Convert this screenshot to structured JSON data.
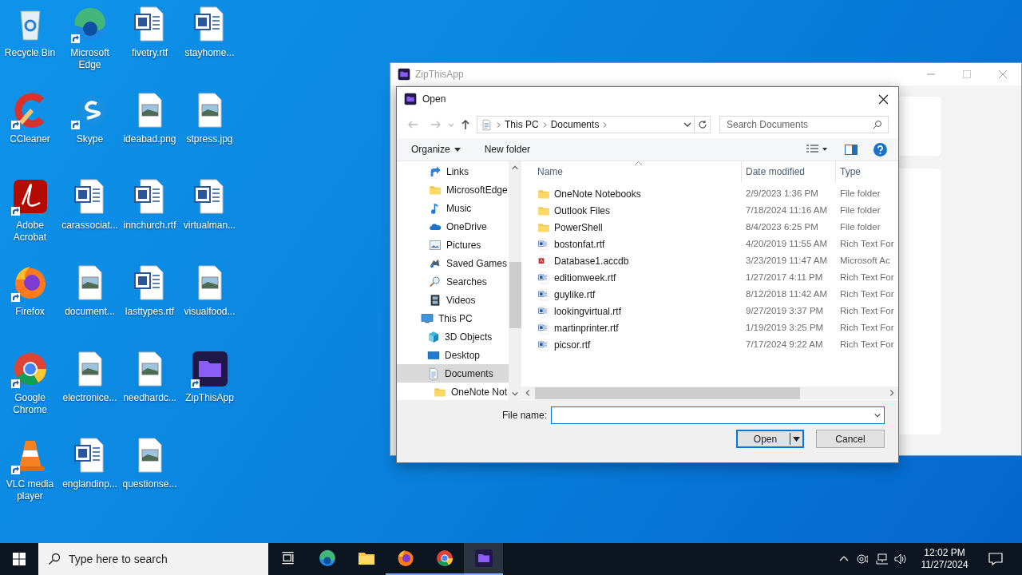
{
  "desktop": {
    "icons": [
      {
        "label": "Recycle Bin",
        "kind": "recycle",
        "shortcut": false
      },
      {
        "label": "CCleaner",
        "kind": "ccleaner",
        "shortcut": true
      },
      {
        "label": "Adobe Acrobat",
        "kind": "acrobat",
        "shortcut": true
      },
      {
        "label": "Firefox",
        "kind": "firefox",
        "shortcut": true
      },
      {
        "label": "Google Chrome",
        "kind": "chrome",
        "shortcut": true
      },
      {
        "label": "VLC media player",
        "kind": "vlc",
        "shortcut": true
      },
      {
        "label": "Microsoft Edge",
        "kind": "edge",
        "shortcut": true
      },
      {
        "label": "Skype",
        "kind": "skype",
        "shortcut": true
      },
      {
        "label": "carassociat...",
        "kind": "word",
        "shortcut": false
      },
      {
        "label": "document...",
        "kind": "image",
        "shortcut": false
      },
      {
        "label": "electronice...",
        "kind": "image",
        "shortcut": false
      },
      {
        "label": "englandinp...",
        "kind": "word",
        "shortcut": false
      },
      {
        "label": "fivetry.rtf",
        "kind": "word",
        "shortcut": false
      },
      {
        "label": "ideabad.png",
        "kind": "image",
        "shortcut": false
      },
      {
        "label": "innchurch.rtf",
        "kind": "word",
        "shortcut": false
      },
      {
        "label": "lasttypes.rtf",
        "kind": "word",
        "shortcut": false
      },
      {
        "label": "needhardc...",
        "kind": "image",
        "shortcut": false
      },
      {
        "label": "questionse...",
        "kind": "image",
        "shortcut": false
      },
      {
        "label": "stayhome...",
        "kind": "word",
        "shortcut": false
      },
      {
        "label": "stpress.jpg",
        "kind": "image",
        "shortcut": false
      },
      {
        "label": "virtualman...",
        "kind": "word",
        "shortcut": false
      },
      {
        "label": "visualfood...",
        "kind": "image",
        "shortcut": false
      },
      {
        "label": "ZipThisApp",
        "kind": "zip",
        "shortcut": true
      }
    ]
  },
  "background_window": {
    "title": "ZipThisApp"
  },
  "dialog": {
    "title": "Open",
    "address": [
      "This PC",
      "Documents"
    ],
    "search": {
      "placeholder": "Search Documents"
    },
    "toolbar": {
      "organize": "Organize",
      "new_folder": "New folder"
    },
    "nav_tree": [
      {
        "label": "Links",
        "kind": "link",
        "selected": false
      },
      {
        "label": "MicrosoftEdge",
        "kind": "folder",
        "selected": false
      },
      {
        "label": "Music",
        "kind": "music",
        "selected": false
      },
      {
        "label": "OneDrive",
        "kind": "onedrive",
        "selected": false
      },
      {
        "label": "Pictures",
        "kind": "pictures",
        "selected": false
      },
      {
        "label": "Saved Games",
        "kind": "games",
        "selected": false
      },
      {
        "label": "Searches",
        "kind": "search",
        "selected": false
      },
      {
        "label": "Videos",
        "kind": "videos",
        "selected": false
      },
      {
        "label": "This PC",
        "kind": "pc",
        "selected": false,
        "children": [
          {
            "label": "3D Objects",
            "kind": "cube",
            "selected": false
          },
          {
            "label": "Desktop",
            "kind": "desktop",
            "selected": false
          },
          {
            "label": "Documents",
            "kind": "documents",
            "selected": true,
            "children": [
              {
                "label": "OneNote Not",
                "kind": "folder",
                "selected": false
              }
            ]
          }
        ]
      }
    ],
    "columns": [
      "Name",
      "Date modified",
      "Type"
    ],
    "files": [
      {
        "name": "OneNote Notebooks",
        "date": "2/9/2023 1:36 PM",
        "type": "File folder",
        "kind": "folder"
      },
      {
        "name": "Outlook Files",
        "date": "7/18/2024 11:16 AM",
        "type": "File folder",
        "kind": "folder"
      },
      {
        "name": "PowerShell",
        "date": "8/4/2023 6:25 PM",
        "type": "File folder",
        "kind": "folder"
      },
      {
        "name": "bostonfat.rtf",
        "date": "4/20/2019 11:55 AM",
        "type": "Rich Text For",
        "kind": "word"
      },
      {
        "name": "Database1.accdb",
        "date": "3/23/2019 11:47 AM",
        "type": "Microsoft Ac",
        "kind": "access"
      },
      {
        "name": "editionweek.rtf",
        "date": "1/27/2017 4:11 PM",
        "type": "Rich Text For",
        "kind": "word"
      },
      {
        "name": "guylike.rtf",
        "date": "8/12/2018 11:42 AM",
        "type": "Rich Text For",
        "kind": "word"
      },
      {
        "name": "lookingvirtual.rtf",
        "date": "9/27/2019 3:37 PM",
        "type": "Rich Text For",
        "kind": "word"
      },
      {
        "name": "martinprinter.rtf",
        "date": "1/19/2019 3:25 PM",
        "type": "Rich Text For",
        "kind": "word"
      },
      {
        "name": "picsor.rtf",
        "date": "7/17/2024 9:22 AM",
        "type": "Rich Text For",
        "kind": "word"
      }
    ],
    "file_name": {
      "label": "File name:"
    },
    "buttons": {
      "open": "Open",
      "cancel": "Cancel"
    }
  },
  "taskbar": {
    "search_placeholder": "Type here to search",
    "apps": [
      {
        "kind": "taskview",
        "active": false
      },
      {
        "kind": "edge",
        "active": false
      },
      {
        "kind": "explorer",
        "active": false
      },
      {
        "kind": "firefox",
        "active": false
      },
      {
        "kind": "chrome",
        "active": false
      },
      {
        "kind": "zip",
        "active": true
      }
    ],
    "time": "12:02 PM",
    "date": "11/27/2024"
  }
}
